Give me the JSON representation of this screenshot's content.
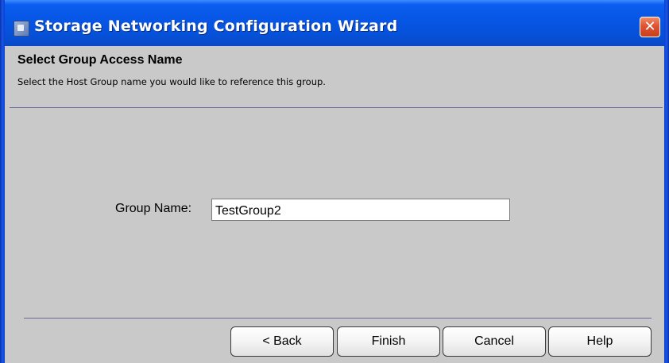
{
  "window": {
    "title": "Storage Networking Configuration Wizard",
    "close_glyph": "✕",
    "title_icon": "app-window-icon",
    "frame_color": "#0756e6"
  },
  "page": {
    "heading": "Select Group Access Name",
    "instruction": "Select the Host Group name you would like to reference this group."
  },
  "form": {
    "group_name_label": "Group Name:",
    "group_name_value": "TestGroup2"
  },
  "buttons": {
    "back": "< Back",
    "finish": "Finish",
    "cancel": "Cancel",
    "help": "Help"
  }
}
